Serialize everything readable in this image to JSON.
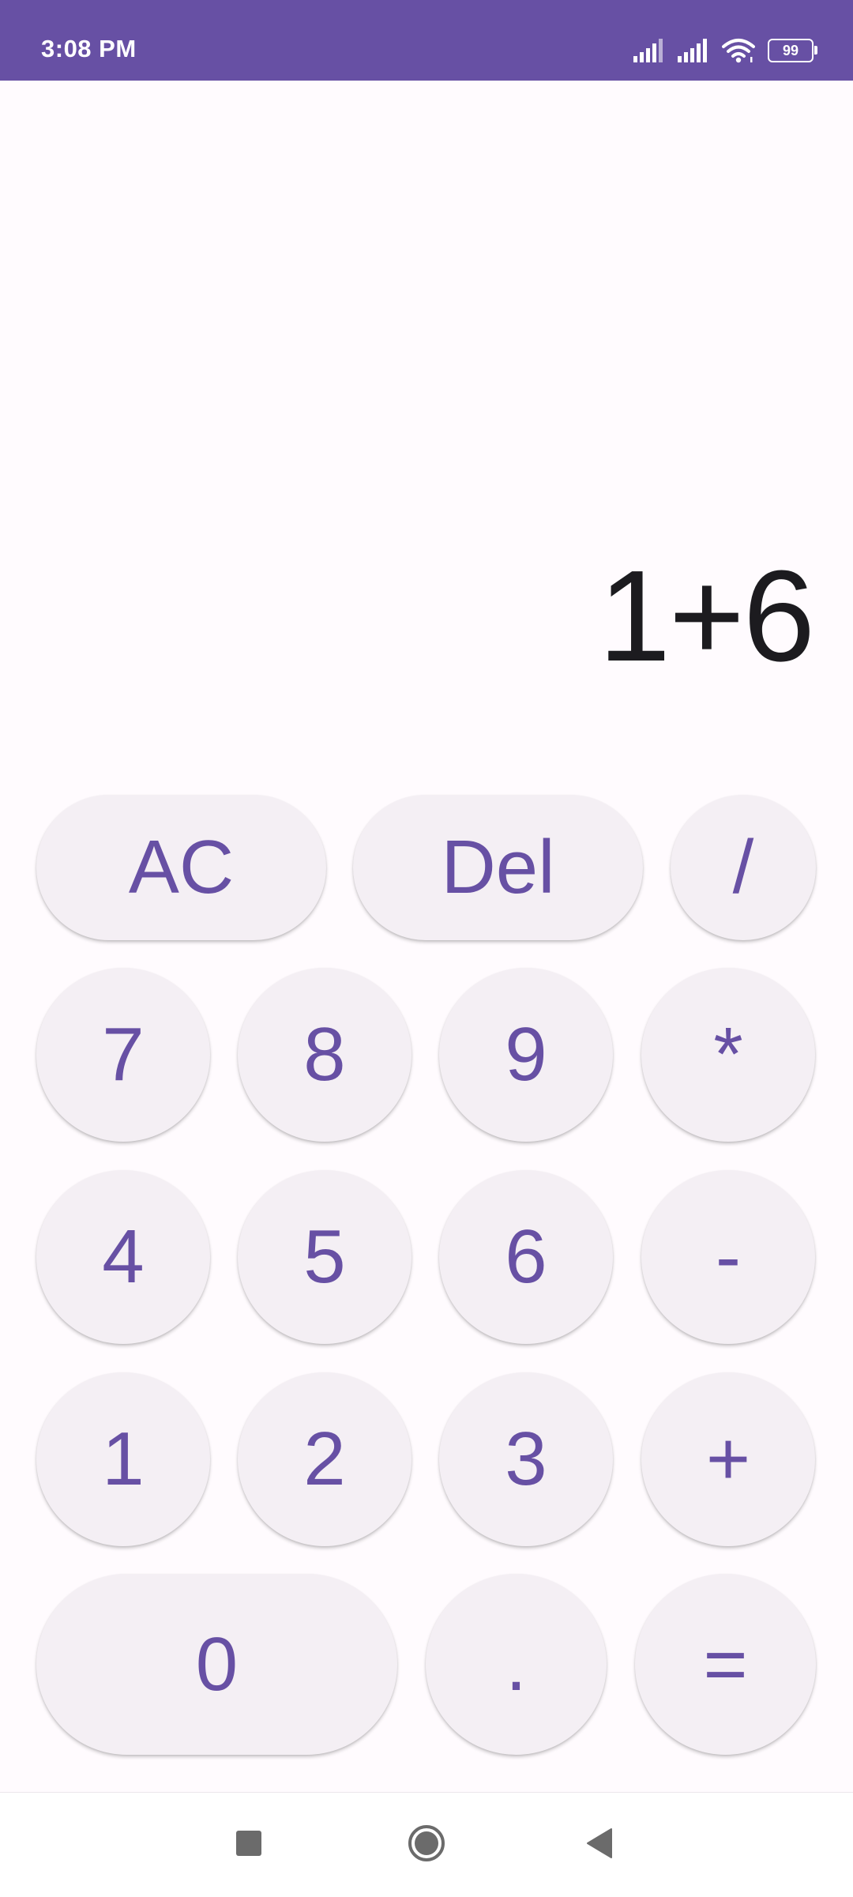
{
  "status_bar": {
    "time": "3:08 PM",
    "battery_level": "99",
    "icons": [
      "signal-icon",
      "signal-icon",
      "wifi-icon",
      "battery-icon"
    ]
  },
  "display": {
    "expression": "1+6"
  },
  "keys": {
    "ac": "AC",
    "del": "Del",
    "divide": "/",
    "seven": "7",
    "eight": "8",
    "nine": "9",
    "multiply": "*",
    "four": "4",
    "five": "5",
    "six": "6",
    "subtract": "-",
    "one": "1",
    "two": "2",
    "three": "3",
    "add": "+",
    "zero": "0",
    "decimal": ".",
    "equals": "="
  },
  "nav_bar": {
    "icons": [
      "recents-icon",
      "home-icon",
      "back-icon"
    ]
  },
  "colors": {
    "accent": "#6750a4",
    "background": "#fffbfe",
    "key_surface": "#f4eff4",
    "display_text": "#1c1b1f"
  }
}
